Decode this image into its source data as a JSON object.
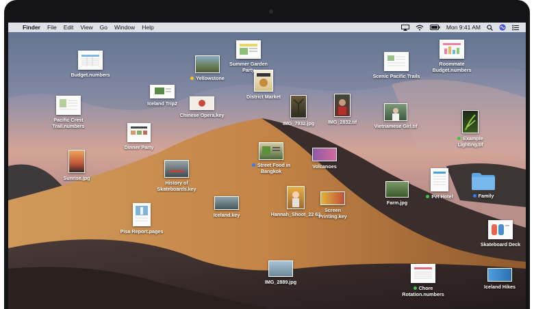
{
  "menubar": {
    "apple": "",
    "app": "Finder",
    "items": [
      "File",
      "Edit",
      "View",
      "Go",
      "Window",
      "Help"
    ],
    "clock": "Mon 9:41 AM"
  },
  "colors": {
    "green_tag": "#3fc24a",
    "yellow_tag": "#f5c723",
    "blue_tag": "#2f7df6",
    "folder_blue": "#5ea8e6"
  },
  "desktop_items": [
    {
      "name": "Budget.numbers"
    },
    {
      "name": "Yellowstone",
      "tag": "yellow"
    },
    {
      "name": "Summer Garden Party"
    },
    {
      "name": "District Market"
    },
    {
      "name": "Scenic Pacific Trails"
    },
    {
      "name": "Roommate Budget.numbers"
    },
    {
      "name": "Iceland Trip2"
    },
    {
      "name": "Pacific Crest Trail.numbers"
    },
    {
      "name": "Chinese Opera.key"
    },
    {
      "name": "IMG_7932.jpg"
    },
    {
      "name": "IMG_2832.tif"
    },
    {
      "name": "Vietnamese Girl.tif"
    },
    {
      "name": "Example Lighting.tif",
      "tag": "green"
    },
    {
      "name": "Dinner Party"
    },
    {
      "name": "Sunrise.jpg"
    },
    {
      "name": "Street Food in Bangkok",
      "tag": "blue"
    },
    {
      "name": "Volcanoes"
    },
    {
      "name": "History of Skateboards.key"
    },
    {
      "name": "Farm.jpg"
    },
    {
      "name": "Pet Hotel",
      "tag": "green"
    },
    {
      "name": "Family",
      "tag": "blue"
    },
    {
      "name": "Hannah_Shoot_22 62"
    },
    {
      "name": "Screen Printing.key"
    },
    {
      "name": "Iceland.key"
    },
    {
      "name": "Pisa Report.pages"
    },
    {
      "name": "Skateboard Deck"
    },
    {
      "name": "IMG_2889.jpg"
    },
    {
      "name": "Chore Rotation.numbers",
      "tag": "green"
    },
    {
      "name": "Iceland Hikes"
    }
  ]
}
